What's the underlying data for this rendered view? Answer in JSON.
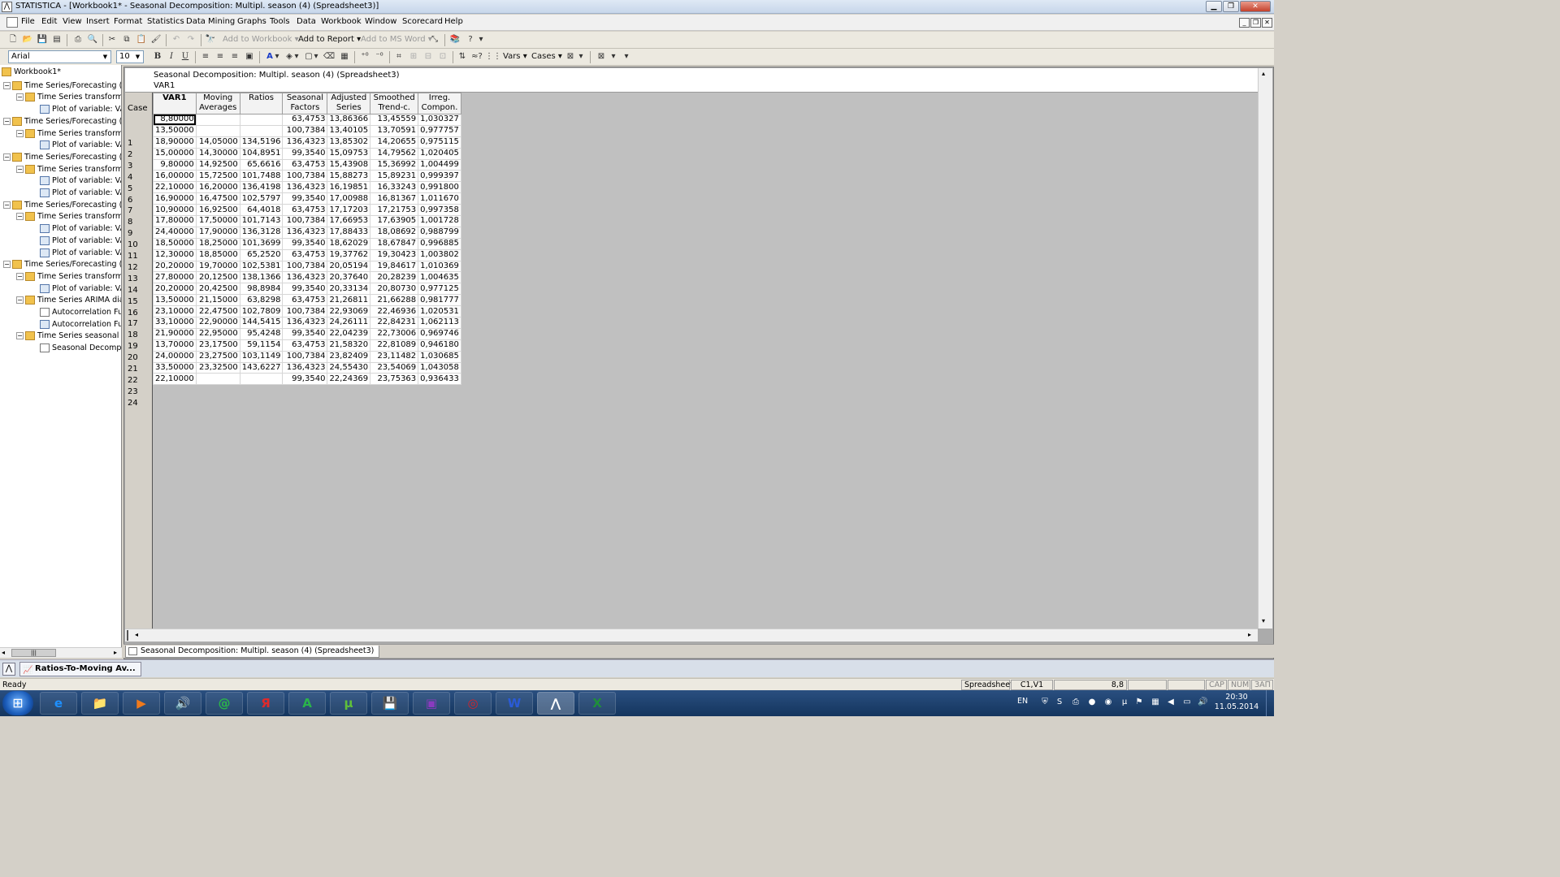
{
  "window": {
    "title": "STATISTICA - [Workbook1* - Seasonal Decomposition: Multipl. season (4) (Spreadsheet3)]"
  },
  "menu": [
    "File",
    "Edit",
    "View",
    "Insert",
    "Format",
    "Statistics",
    "Data Mining",
    "Graphs",
    "Tools",
    "Data",
    "Workbook",
    "Window",
    "Scorecard",
    "Help"
  ],
  "toolbar": {
    "add_to_workbook": "Add to Workbook",
    "add_to_report": "Add to Report",
    "add_to_msword": "Add to MS Word",
    "vars": "Vars",
    "cases": "Cases",
    "font_name": "Arial",
    "font_size": "10",
    "bold": "B",
    "italic": "I",
    "underline": "U"
  },
  "tree": [
    {
      "level": 0,
      "icon": "folder",
      "label": "Workbook1*",
      "exp": ""
    },
    {
      "level": 1,
      "icon": "folder",
      "label": "Time Series/Forecasting (S",
      "exp": "−"
    },
    {
      "level": 2,
      "icon": "folder",
      "label": "Time Series transforma",
      "exp": "−"
    },
    {
      "level": 3,
      "icon": "plot",
      "label": "Plot of variable: VAI",
      "exp": ""
    },
    {
      "level": 1,
      "icon": "folder",
      "label": "Time Series/Forecasting (S",
      "exp": "−"
    },
    {
      "level": 2,
      "icon": "folder",
      "label": "Time Series transforma",
      "exp": "−"
    },
    {
      "level": 3,
      "icon": "plot",
      "label": "Plot of variable: VAI",
      "exp": ""
    },
    {
      "level": 1,
      "icon": "folder",
      "label": "Time Series/Forecasting (S",
      "exp": "−"
    },
    {
      "level": 2,
      "icon": "folder",
      "label": "Time Series transforma",
      "exp": "−"
    },
    {
      "level": 3,
      "icon": "plot",
      "label": "Plot of variable: VAI",
      "exp": ""
    },
    {
      "level": 3,
      "icon": "plot",
      "label": "Plot of variable: VAI",
      "exp": ""
    },
    {
      "level": 1,
      "icon": "folder",
      "label": "Time Series/Forecasting (S",
      "exp": "−"
    },
    {
      "level": 2,
      "icon": "folder",
      "label": "Time Series transforma",
      "exp": "−"
    },
    {
      "level": 3,
      "icon": "plot",
      "label": "Plot of variable: VAI",
      "exp": ""
    },
    {
      "level": 3,
      "icon": "plot",
      "label": "Plot of variable: VAI",
      "exp": ""
    },
    {
      "level": 3,
      "icon": "plot",
      "label": "Plot of variable: VAI",
      "exp": ""
    },
    {
      "level": 1,
      "icon": "folder",
      "label": "Time Series/Forecasting (S",
      "exp": "−"
    },
    {
      "level": 2,
      "icon": "folder",
      "label": "Time Series transforma",
      "exp": "−"
    },
    {
      "level": 3,
      "icon": "plot",
      "label": "Plot of variable: VAI",
      "exp": ""
    },
    {
      "level": 2,
      "icon": "folder",
      "label": "Time Series ARIMA dial",
      "exp": "−"
    },
    {
      "level": 3,
      "icon": "sheet",
      "label": "Autocorrelation Fur",
      "exp": ""
    },
    {
      "level": 3,
      "icon": "plot",
      "label": "Autocorrelation Fur",
      "exp": ""
    },
    {
      "level": 2,
      "icon": "folder",
      "label": "Time Series seasonal de",
      "exp": "−"
    },
    {
      "level": 3,
      "icon": "sheet",
      "label": "Seasonal Decompo",
      "exp": ""
    }
  ],
  "sheet": {
    "title": "Seasonal Decomposition: Multipl. season (4) (Spreadsheet3)",
    "subtitle": "VAR1",
    "case_label": "Case",
    "columns": [
      {
        "label": "VAR1",
        "bold": true,
        "w": 49
      },
      {
        "label": "Moving\nAverages",
        "bold": false,
        "w": 54
      },
      {
        "label": "Ratios",
        "bold": false,
        "w": 50
      },
      {
        "label": "Seasonal\nFactors",
        "bold": false,
        "w": 55
      },
      {
        "label": "Adjusted\nSeries",
        "bold": false,
        "w": 51
      },
      {
        "label": "Smoothed\nTrend-c.",
        "bold": false,
        "w": 59
      },
      {
        "label": "Irreg.\nCompon.",
        "bold": false,
        "w": 52
      }
    ],
    "rows": [
      [
        "1",
        "8,80000",
        "",
        "",
        "63,4753",
        "13,86366",
        "13,45559",
        "1,030327"
      ],
      [
        "2",
        "13,50000",
        "",
        "",
        "100,7384",
        "13,40105",
        "13,70591",
        "0,977757"
      ],
      [
        "3",
        "18,90000",
        "14,05000",
        "134,5196",
        "136,4323",
        "13,85302",
        "14,20655",
        "0,975115"
      ],
      [
        "4",
        "15,00000",
        "14,30000",
        "104,8951",
        "99,3540",
        "15,09753",
        "14,79562",
        "1,020405"
      ],
      [
        "5",
        "9,80000",
        "14,92500",
        "65,6616",
        "63,4753",
        "15,43908",
        "15,36992",
        "1,004499"
      ],
      [
        "6",
        "16,00000",
        "15,72500",
        "101,7488",
        "100,7384",
        "15,88273",
        "15,89231",
        "0,999397"
      ],
      [
        "7",
        "22,10000",
        "16,20000",
        "136,4198",
        "136,4323",
        "16,19851",
        "16,33243",
        "0,991800"
      ],
      [
        "8",
        "16,90000",
        "16,47500",
        "102,5797",
        "99,3540",
        "17,00988",
        "16,81367",
        "1,011670"
      ],
      [
        "9",
        "10,90000",
        "16,92500",
        "64,4018",
        "63,4753",
        "17,17203",
        "17,21753",
        "0,997358"
      ],
      [
        "10",
        "17,80000",
        "17,50000",
        "101,7143",
        "100,7384",
        "17,66953",
        "17,63905",
        "1,001728"
      ],
      [
        "11",
        "24,40000",
        "17,90000",
        "136,3128",
        "136,4323",
        "17,88433",
        "18,08692",
        "0,988799"
      ],
      [
        "12",
        "18,50000",
        "18,25000",
        "101,3699",
        "99,3540",
        "18,62029",
        "18,67847",
        "0,996885"
      ],
      [
        "13",
        "12,30000",
        "18,85000",
        "65,2520",
        "63,4753",
        "19,37762",
        "19,30423",
        "1,003802"
      ],
      [
        "14",
        "20,20000",
        "19,70000",
        "102,5381",
        "100,7384",
        "20,05194",
        "19,84617",
        "1,010369"
      ],
      [
        "15",
        "27,80000",
        "20,12500",
        "138,1366",
        "136,4323",
        "20,37640",
        "20,28239",
        "1,004635"
      ],
      [
        "16",
        "20,20000",
        "20,42500",
        "98,8984",
        "99,3540",
        "20,33134",
        "20,80730",
        "0,977125"
      ],
      [
        "17",
        "13,50000",
        "21,15000",
        "63,8298",
        "63,4753",
        "21,26811",
        "21,66288",
        "0,981777"
      ],
      [
        "18",
        "23,10000",
        "22,47500",
        "102,7809",
        "100,7384",
        "22,93069",
        "22,46936",
        "1,020531"
      ],
      [
        "19",
        "33,10000",
        "22,90000",
        "144,5415",
        "136,4323",
        "24,26111",
        "22,84231",
        "1,062113"
      ],
      [
        "20",
        "21,90000",
        "22,95000",
        "95,4248",
        "99,3540",
        "22,04239",
        "22,73006",
        "0,969746"
      ],
      [
        "21",
        "13,70000",
        "23,17500",
        "59,1154",
        "63,4753",
        "21,58320",
        "22,81089",
        "0,946180"
      ],
      [
        "22",
        "24,00000",
        "23,27500",
        "103,1149",
        "100,7384",
        "23,82409",
        "23,11482",
        "1,030685"
      ],
      [
        "23",
        "33,50000",
        "23,32500",
        "143,6227",
        "136,4323",
        "24,55430",
        "23,54069",
        "1,043058"
      ],
      [
        "24",
        "22,10000",
        "",
        "",
        "99,3540",
        "22,24369",
        "23,75363",
        "0,936433"
      ]
    ]
  },
  "sheet_tab": "Seasonal Decomposition: Multipl. season (4) (Spreadsheet3)",
  "window_tab": "Ratios-To-Moving Av...",
  "status": {
    "ready": "Ready",
    "sheet": "Spreadsheet3",
    "cell": "C1,V1",
    "value": "8,8",
    "cap": "CAP",
    "num": "NUM",
    "zap": "ЗАП"
  },
  "taskbar": {
    "lang": "EN",
    "time": "20:30",
    "date": "11.05.2014",
    "apps": [
      "e",
      "📁",
      "▶",
      "🔊",
      "@",
      "Я",
      "A",
      "µ",
      "💾",
      "▣",
      "◎",
      "W",
      "⋀",
      "X"
    ]
  },
  "icons": {
    "folder": "folder-icon",
    "plot": "plot-icon",
    "sheet": "spreadsheet-icon"
  }
}
